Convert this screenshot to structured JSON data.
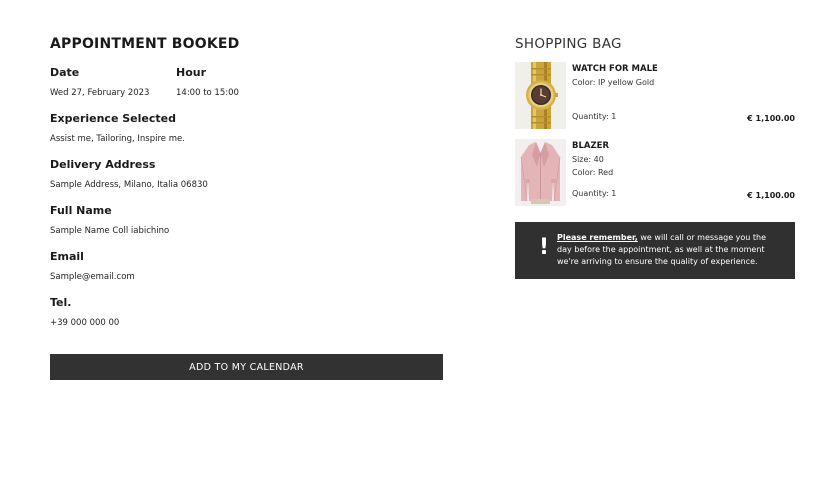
{
  "appointment": {
    "title": "APPOINTMENT BOOKED",
    "date_label": "Date",
    "date_value": "Wed 27, February 2023",
    "hour_label": "Hour",
    "hour_value": "14:00 to 15:00",
    "experience_label": "Experience Selected",
    "experience_value": "Assist me, Tailoring, Inspire me.",
    "address_label": "Delivery Address",
    "address_value": "Sample Address, Milano, Italia 06830",
    "name_label": "Full Name",
    "name_value": "Sample Name Coll iabichino",
    "email_label": "Email",
    "email_value": "Sample@email.com",
    "tel_label": "Tel.",
    "tel_value": "+39 000 000 00",
    "cta_label": "ADD TO MY CALENDAR"
  },
  "bag": {
    "title": "SHOPPING BAG",
    "items": [
      {
        "name": "WATCH FOR MALE",
        "attrs": [
          "Color: IP yellow Gold"
        ],
        "quantity": "Quantity: 1",
        "price": "€ 1,100.00",
        "image_icon": "gold-watch-image"
      },
      {
        "name": "BLAZER",
        "attrs": [
          "Size: 40",
          "Color: Red"
        ],
        "quantity": "Quantity: 1",
        "price": "€ 1,100.00",
        "image_icon": "pink-blazer-image"
      }
    ]
  },
  "notice": {
    "icon": "exclamation-icon",
    "emphasis": "Please remember,",
    "text": " we will call or message you the day before the appointment, as well at the moment we're arriving to ensure the quality of experience."
  },
  "colors": {
    "dark": "#323232",
    "text": "#1a1a1a",
    "background": "#ffffff"
  }
}
